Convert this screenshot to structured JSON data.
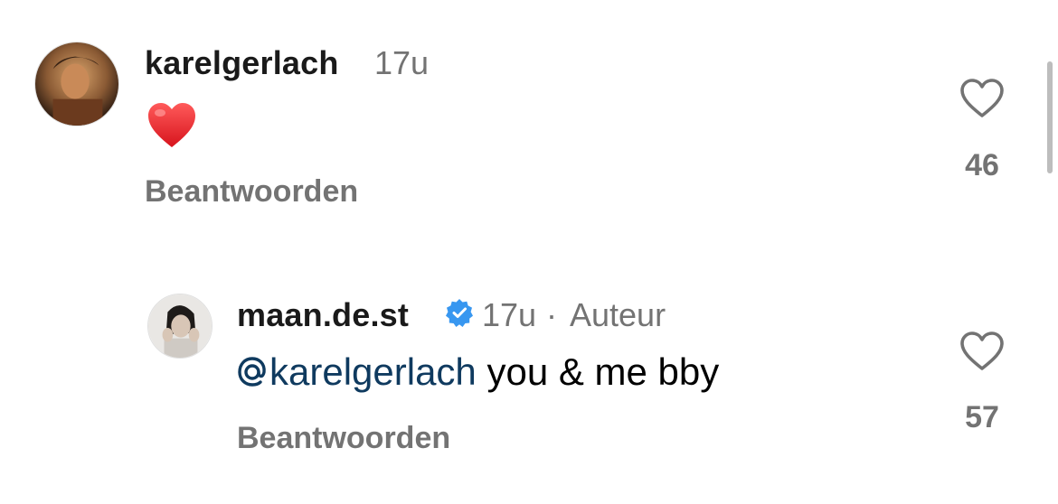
{
  "comments": [
    {
      "username": "karelgerlach",
      "time": "17u",
      "body_emoji": "heart",
      "reply_label": "Beantwoorden",
      "like_count": "46"
    },
    {
      "username": "maan.de.st",
      "verified": true,
      "time": "17u",
      "separator": "·",
      "author_label": "Auteur",
      "mention": "karelgerlach",
      "body_text": " you & me bby",
      "reply_label": "Beantwoorden",
      "like_count": "57"
    }
  ],
  "colors": {
    "muted": "#737373",
    "mention": "#0f3a5f",
    "verified": "#3897f0",
    "heart": "#e0245e"
  }
}
